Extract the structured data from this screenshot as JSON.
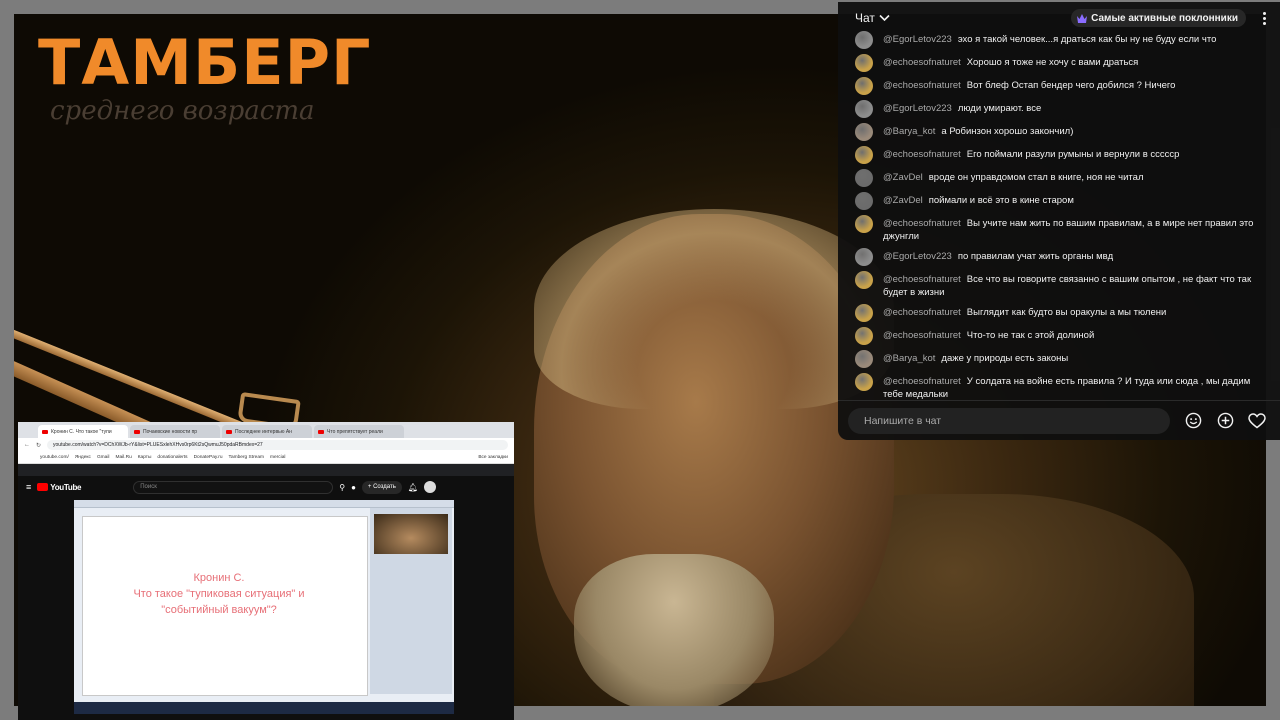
{
  "colors": {
    "brand_orange": "#f08a2a",
    "chat_bg": "#0f0f0f",
    "chat_text": "#f1f1f1",
    "author": "#aaaaaa"
  },
  "logo": {
    "title": "ТАМБЕРГ",
    "subtitle": "среднего возраста"
  },
  "chat": {
    "title": "Чат",
    "top_fans_label": "Самые активные поклонники",
    "input_placeholder": "Напишите в чат",
    "messages": [
      {
        "author": "@EgorLetov223",
        "text": "эхо я такой человек...я драться как бы ну не буду если что",
        "avatar": "#8d8d8d"
      },
      {
        "author": "@echoesofnaturet",
        "text": "Хорошо я тоже не хочу с вами драться",
        "avatar": "#c9a24a"
      },
      {
        "author": "@echoesofnaturet",
        "text": "Вот блеф Остап бендер чего добился ? Ничего",
        "avatar": "#c9a24a"
      },
      {
        "author": "@EgorLetov223",
        "text": "люди умирают. все",
        "avatar": "#8d8d8d"
      },
      {
        "author": "@Barya_kot",
        "text": "а Робинзон хорошо закончил)",
        "avatar": "#9a8a7a"
      },
      {
        "author": "@echoesofnaturet",
        "text": "Его поймали разули румыны и вернули в ссссср",
        "avatar": "#c9a24a"
      },
      {
        "author": "@ZavDel",
        "text": "вроде он управдомом стал в книге, ноя не читал",
        "avatar": "#6b6b6b"
      },
      {
        "author": "@ZavDel",
        "text": "поймали и всё это в кине старом",
        "avatar": "#6b6b6b"
      },
      {
        "author": "@echoesofnaturet",
        "text": "Вы учите нам жить по вашим правилам, а в мире нет правил это джунгли",
        "avatar": "#c9a24a"
      },
      {
        "author": "@EgorLetov223",
        "text": "по правилам учат жить органы мвд",
        "avatar": "#8d8d8d"
      },
      {
        "author": "@echoesofnaturet",
        "text": "Все что вы говорите связанно с вашим опытом , не факт что так будет в жизни",
        "avatar": "#c9a24a"
      },
      {
        "author": "@echoesofnaturet",
        "text": "Выглядит как будто вы оракулы а мы тюлени",
        "avatar": "#c9a24a"
      },
      {
        "author": "@echoesofnaturet",
        "text": "Что-то не так с этой долиной",
        "avatar": "#c9a24a"
      },
      {
        "author": "@Barya_kot",
        "text": "даже у природы есть законы",
        "avatar": "#9a8a7a"
      },
      {
        "author": "@echoesofnaturet",
        "text": "У солдата на войне есть правила ? И туда или сюда , мы дадим тебе медальки",
        "avatar": "#c9a24a"
      }
    ]
  },
  "pip": {
    "tabs": [
      "Кронин С. Что такое \"тупи",
      "Почаевские новости пр",
      "Последнее интервью Ан",
      "Что препятствует реали"
    ],
    "url": "youtube.com/watch?v=DChXWJb-rY&list=PLUESxlehXHvs0rp6Kt2sQwmuJ50pdaRBmdex=27",
    "bookmarks": [
      "youtube.com/",
      "Яндекс",
      "Gmail",
      "Mail.Ru",
      "Карты",
      "donationalerts",
      "DonatePay.ru",
      "Tamberg Stream",
      "mercial",
      "Все закладки"
    ],
    "yt_brand": "YouTube",
    "search_placeholder": "Поиск",
    "create_label": "Создать",
    "video_text": "Кронин С.\nЧто такое \"тупиковая ситуация\" и\n\"событийный вакуум\"?"
  }
}
